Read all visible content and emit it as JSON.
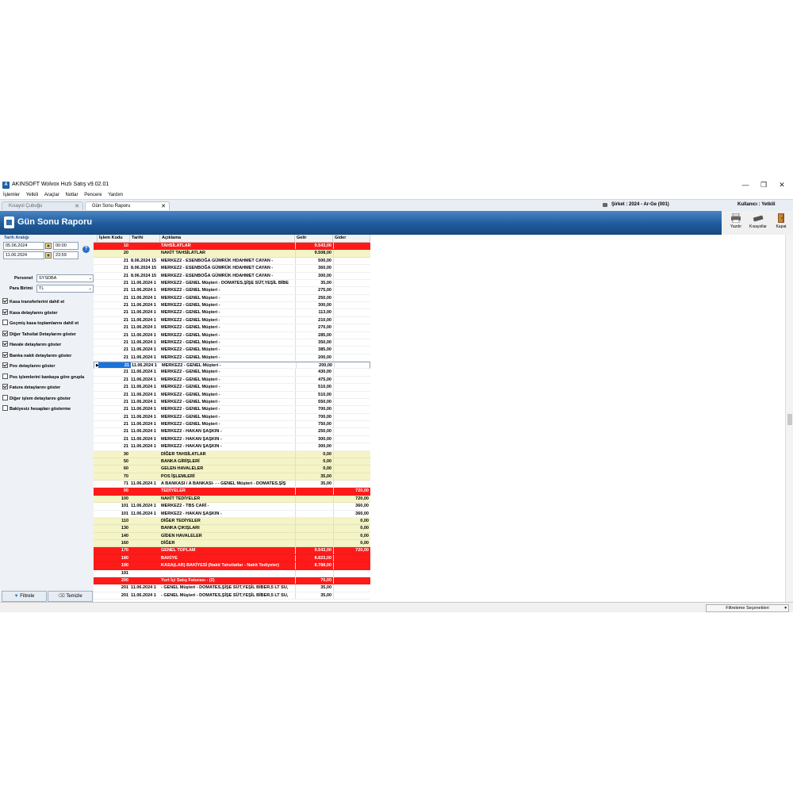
{
  "window": {
    "title": "AKINSOFT Wolvox Hızlı Satış v9.02.01",
    "icon_label": "A",
    "controls": {
      "minimize": "—",
      "maximize": "❐",
      "close": "✕"
    }
  },
  "menu": [
    "İşlemler",
    "Yetkili",
    "Araçlar",
    "Notlar",
    "Pencere",
    "Yardım"
  ],
  "tabs": {
    "tab1": "Kısayol Çubuğu",
    "tab2": "Gün Sonu Raporu",
    "close": "✕"
  },
  "company": {
    "sirket": "Şirket : 2024 - Ar-Ge (001)",
    "kullanici": "Kullanıcı : Yetkili"
  },
  "header": {
    "title": "Gün Sonu Raporu"
  },
  "toolbar": {
    "print": "Yazdır",
    "shortcuts": "Kısayollar",
    "close": "Kapat"
  },
  "filters": {
    "date_range_label": "Tarih Aralığı",
    "date_from": "05.06.2024",
    "time_from": "00:00",
    "date_to": "11.06.2024",
    "time_to": "23:59",
    "help": "?",
    "personel_label": "Personel",
    "personel_value": "SYSDBA",
    "currency_label": "Para Birimi",
    "currency_value": "TL",
    "checkboxes": [
      {
        "label": "Kasa transferlerini dahil et",
        "checked": true
      },
      {
        "label": "Kasa detaylarını göster",
        "checked": true
      },
      {
        "label": "Geçmiş kasa toplamlarını dahil et",
        "checked": false
      },
      {
        "label": "Diğer Tahsilat Detaylarını göster",
        "checked": true
      },
      {
        "label": "Havale detaylarını göster",
        "checked": true
      },
      {
        "label": "Banka nakit detaylarını göster",
        "checked": true
      },
      {
        "label": "Pos detaylarını göster",
        "checked": true
      },
      {
        "label": "Pos işlemlerini bankaya göre grupla",
        "checked": false
      },
      {
        "label": "Fatura detaylarını göster",
        "checked": true
      },
      {
        "label": "Diğer işlem detaylarını göster",
        "checked": false
      },
      {
        "label": "Bakiyesiz hesapları gösterme",
        "checked": false
      }
    ],
    "filter_button": "Filtrele",
    "clear_button": "Temizle"
  },
  "grid": {
    "columns": {
      "kod": "İşlem Kodu",
      "tarih": "Tarihi",
      "aciklama": "Açıklama",
      "gelir": "Gelir",
      "gider": "Gider"
    },
    "rows": [
      {
        "kod": "10",
        "tarih": "",
        "aciklama": "TAHSİLATLAR",
        "gelir": "9.543,00",
        "gider": "",
        "style": "red"
      },
      {
        "kod": "20",
        "tarih": "",
        "aciklama": "NAKİT TAHSİLATLAR",
        "gelir": "9.508,00",
        "gider": "",
        "style": "yel"
      },
      {
        "kod": "21",
        "tarih": "8.06.2024 15",
        "aciklama": "MERKEZ2 - ESENBOĞA GÜMRÜK HDAHMET CAYAN -",
        "gelir": "500,00",
        "gider": "",
        "style": "wht"
      },
      {
        "kod": "21",
        "tarih": "8.06.2024 15",
        "aciklama": "MERKEZ2 - ESENBOĞA GÜMRÜK HDAHMET CAYAN -",
        "gelir": "360,00",
        "gider": "",
        "style": "wht"
      },
      {
        "kod": "21",
        "tarih": "8.06.2024 15",
        "aciklama": "MERKEZ2 - ESENBOĞA GÜMRÜK HDAHMET CAYAN -",
        "gelir": "300,00",
        "gider": "",
        "style": "wht"
      },
      {
        "kod": "21",
        "tarih": "11.06.2024 1",
        "aciklama": "MERKEZ2 - GENEL Müşteri - DOMATES,ŞİŞE SÜT,YEŞİL BİBE",
        "gelir": "35,00",
        "gider": "",
        "style": "wht"
      },
      {
        "kod": "21",
        "tarih": "11.06.2024 1",
        "aciklama": "MERKEZ2 - GENEL Müşteri -",
        "gelir": "275,00",
        "gider": "",
        "style": "wht"
      },
      {
        "kod": "21",
        "tarih": "11.06.2024 1",
        "aciklama": "MERKEZ2 - GENEL Müşteri -",
        "gelir": "250,00",
        "gider": "",
        "style": "wht"
      },
      {
        "kod": "21",
        "tarih": "11.06.2024 1",
        "aciklama": "MERKEZ2 - GENEL Müşteri -",
        "gelir": "300,00",
        "gider": "",
        "style": "wht"
      },
      {
        "kod": "21",
        "tarih": "11.06.2024 1",
        "aciklama": "MERKEZ2 - GENEL Müşteri -",
        "gelir": "113,00",
        "gider": "",
        "style": "wht"
      },
      {
        "kod": "21",
        "tarih": "11.06.2024 1",
        "aciklama": "MERKEZ2 - GENEL Müşteri -",
        "gelir": "210,00",
        "gider": "",
        "style": "wht"
      },
      {
        "kod": "21",
        "tarih": "11.06.2024 1",
        "aciklama": "MERKEZ2 - GENEL Müşteri -",
        "gelir": "270,00",
        "gider": "",
        "style": "wht"
      },
      {
        "kod": "21",
        "tarih": "11.06.2024 1",
        "aciklama": "MERKEZ2 - GENEL Müşteri -",
        "gelir": "285,00",
        "gider": "",
        "style": "wht"
      },
      {
        "kod": "21",
        "tarih": "11.06.2024 1",
        "aciklama": "MERKEZ2 - GENEL Müşteri -",
        "gelir": "350,00",
        "gider": "",
        "style": "wht"
      },
      {
        "kod": "21",
        "tarih": "11.06.2024 1",
        "aciklama": "MERKEZ2 - GENEL Müşteri -",
        "gelir": "385,00",
        "gider": "",
        "style": "wht"
      },
      {
        "kod": "21",
        "tarih": "11.06.2024 1",
        "aciklama": "MERKEZ2 - GENEL Müşteri -",
        "gelir": "200,00",
        "gider": "",
        "style": "wht"
      },
      {
        "kod": "21",
        "tarih": "11.06.2024 1",
        "aciklama": "MERKEZ2 - GENEL Müşteri -",
        "gelir": "200,00",
        "gider": "",
        "style": "wht",
        "selected": true
      },
      {
        "kod": "21",
        "tarih": "11.06.2024 1",
        "aciklama": "MERKEZ2 - GENEL Müşteri -",
        "gelir": "430,00",
        "gider": "",
        "style": "wht"
      },
      {
        "kod": "21",
        "tarih": "11.06.2024 1",
        "aciklama": "MERKEZ2 - GENEL Müşteri -",
        "gelir": "475,00",
        "gider": "",
        "style": "wht"
      },
      {
        "kod": "21",
        "tarih": "11.06.2024 1",
        "aciklama": "MERKEZ2 - GENEL Müşteri -",
        "gelir": "510,00",
        "gider": "",
        "style": "wht"
      },
      {
        "kod": "21",
        "tarih": "11.06.2024 1",
        "aciklama": "MERKEZ2 - GENEL Müşteri -",
        "gelir": "510,00",
        "gider": "",
        "style": "wht"
      },
      {
        "kod": "21",
        "tarih": "11.06.2024 1",
        "aciklama": "MERKEZ2 - GENEL Müşteri -",
        "gelir": "550,00",
        "gider": "",
        "style": "wht"
      },
      {
        "kod": "21",
        "tarih": "11.06.2024 1",
        "aciklama": "MERKEZ2 - GENEL Müşteri -",
        "gelir": "700,00",
        "gider": "",
        "style": "wht"
      },
      {
        "kod": "21",
        "tarih": "11.06.2024 1",
        "aciklama": "MERKEZ2 - GENEL Müşteri -",
        "gelir": "700,00",
        "gider": "",
        "style": "wht"
      },
      {
        "kod": "21",
        "tarih": "11.06.2024 1",
        "aciklama": "MERKEZ2 - GENEL Müşteri -",
        "gelir": "750,00",
        "gider": "",
        "style": "wht"
      },
      {
        "kod": "21",
        "tarih": "11.06.2024 1",
        "aciklama": "MERKEZ2 - HAKAN ŞAŞKIN -",
        "gelir": "250,00",
        "gider": "",
        "style": "wht"
      },
      {
        "kod": "21",
        "tarih": "11.06.2024 1",
        "aciklama": "MERKEZ2 - HAKAN ŞAŞKIN -",
        "gelir": "300,00",
        "gider": "",
        "style": "wht"
      },
      {
        "kod": "21",
        "tarih": "11.06.2024 1",
        "aciklama": "MERKEZ2 - HAKAN ŞAŞKIN -",
        "gelir": "300,00",
        "gider": "",
        "style": "wht"
      },
      {
        "kod": "30",
        "tarih": "",
        "aciklama": "DİĞER TAHSİLATLAR",
        "gelir": "0,00",
        "gider": "",
        "style": "yel"
      },
      {
        "kod": "50",
        "tarih": "",
        "aciklama": "BANKA GİRİŞLERİ",
        "gelir": "0,00",
        "gider": "",
        "style": "yel"
      },
      {
        "kod": "60",
        "tarih": "",
        "aciklama": "GELEN HAVALELER",
        "gelir": "0,00",
        "gider": "",
        "style": "yel"
      },
      {
        "kod": "70",
        "tarih": "",
        "aciklama": "POS İŞLEMLERİ",
        "gelir": "35,00",
        "gider": "",
        "style": "yel"
      },
      {
        "kod": "71",
        "tarih": "11.06.2024 1",
        "aciklama": "A BANKASI / A BANKASI- - - GENEL Müşteri - DOMATES,ŞİŞ",
        "gelir": "35,00",
        "gider": "",
        "style": "wht"
      },
      {
        "kod": "90",
        "tarih": "",
        "aciklama": "TEDİYELER",
        "gelir": "",
        "gider": "720,00",
        "style": "red"
      },
      {
        "kod": "100",
        "tarih": "",
        "aciklama": "NAKİT TEDİYELER",
        "gelir": "",
        "gider": "720,00",
        "style": "yel"
      },
      {
        "kod": "101",
        "tarih": "11.06.2024 1",
        "aciklama": "MERKEZ2 - TBS CARİ -",
        "gelir": "",
        "gider": "360,00",
        "style": "wht"
      },
      {
        "kod": "101",
        "tarih": "11.06.2024 1",
        "aciklama": "MERKEZ2 - HAKAN ŞAŞKIN -",
        "gelir": "",
        "gider": "360,00",
        "style": "wht"
      },
      {
        "kod": "110",
        "tarih": "",
        "aciklama": "DİĞER TEDİYELER",
        "gelir": "",
        "gider": "0,00",
        "style": "yel"
      },
      {
        "kod": "130",
        "tarih": "",
        "aciklama": "BANKA ÇIKIŞLARI",
        "gelir": "",
        "gider": "0,00",
        "style": "yel"
      },
      {
        "kod": "140",
        "tarih": "",
        "aciklama": "GİDEN HAVALELER",
        "gelir": "",
        "gider": "0,00",
        "style": "yel"
      },
      {
        "kod": "160",
        "tarih": "",
        "aciklama": "DİĞER",
        "gelir": "",
        "gider": "0,00",
        "style": "yel"
      },
      {
        "kod": "170",
        "tarih": "",
        "aciklama": "GENEL TOPLAM",
        "gelir": "9.543,00",
        "gider": "720,00",
        "style": "red"
      },
      {
        "kod": "180",
        "tarih": "",
        "aciklama": "BAKİYE",
        "gelir": "8.823,00",
        "gider": "",
        "style": "red"
      },
      {
        "kod": "190",
        "tarih": "",
        "aciklama": "KASA(LAR) BAKİYESİ (Nakit Tahsilatlar - Nakit Tediyeler)",
        "gelir": "8.788,00",
        "gider": "",
        "style": "red"
      },
      {
        "kod": "191",
        "tarih": "",
        "aciklama": "",
        "gelir": "",
        "gider": "",
        "style": "wht"
      },
      {
        "kod": "200",
        "tarih": "",
        "aciklama": "Yurt İçi Satış Faturası - (2)",
        "gelir": "70,00",
        "gider": "",
        "style": "red"
      },
      {
        "kod": "201",
        "tarih": "11.06.2024 1",
        "aciklama": "- GENEL Müşteri - DOMATES,ŞİŞE SÜT,YEŞİL BİBER,5 LT SU,",
        "gelir": "35,00",
        "gider": "",
        "style": "wht"
      },
      {
        "kod": "201",
        "tarih": "11.06.2024 1",
        "aciklama": "- GENEL Müşteri - DOMATES,ŞİŞE SÜT,YEŞİL BİBER,5 LT SU,",
        "gelir": "35,00",
        "gider": "",
        "style": "wht"
      }
    ]
  },
  "statusbar": {
    "filter_options": "Filtreleme Seçenekleri"
  },
  "colors": {
    "red_row": "#ff1a1a",
    "yellow_row": "#f4f4c7",
    "header_blue": "#1f5b9b",
    "selection": "#1a73d9"
  }
}
